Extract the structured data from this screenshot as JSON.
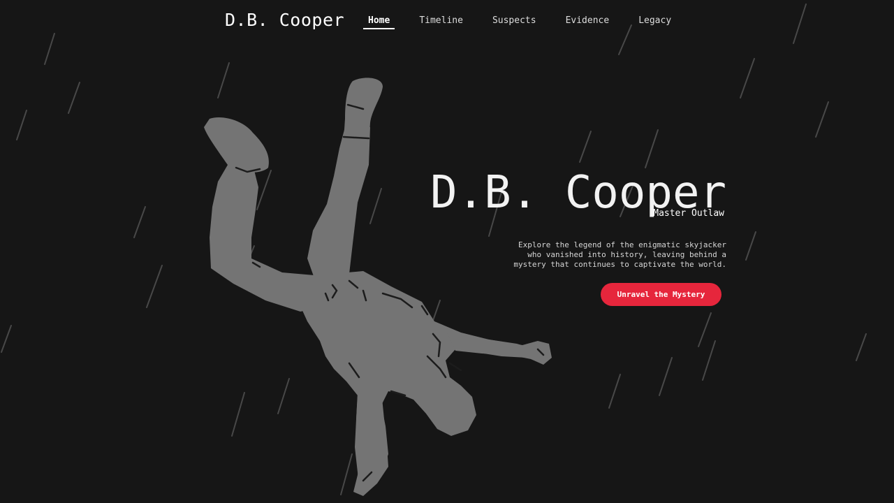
{
  "navbar": {
    "brand": "D.B. Cooper",
    "links": [
      {
        "label": "Home",
        "active": true
      },
      {
        "label": "Timeline",
        "active": false
      },
      {
        "label": "Suspects",
        "active": false
      },
      {
        "label": "Evidence",
        "active": false
      },
      {
        "label": "Legacy",
        "active": false
      }
    ]
  },
  "hero": {
    "title": "D.B. Cooper",
    "subtitle": "Master Outlaw",
    "description_lines": [
      "Explore the legend of the enigmatic skyjacker",
      "who vanished into history, leaving behind a",
      "mystery that continues to captivate the world."
    ],
    "cta_label": "Unravel the Mystery"
  },
  "colors": {
    "background": "#161616",
    "accent": "#e6263c",
    "figure": "#747474",
    "rain": "#5a5a5a"
  },
  "icons": {
    "figure": "skydiver-silhouette-icon"
  }
}
